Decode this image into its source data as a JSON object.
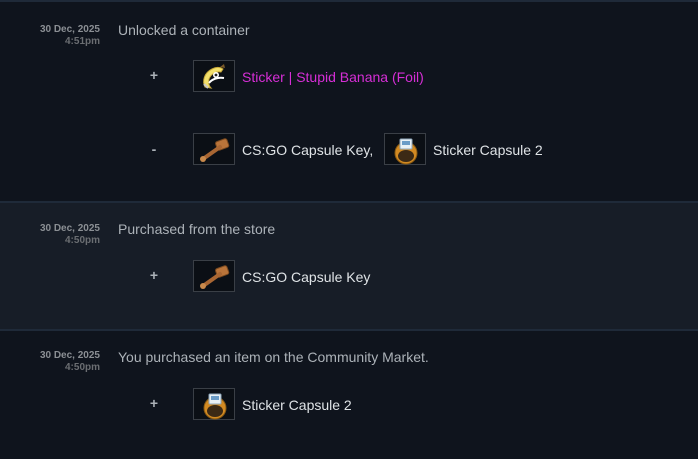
{
  "entries": [
    {
      "date": "30 Dec, 2025",
      "time": "4:51pm",
      "description": "Unlocked a container",
      "groups": [
        {
          "sign": "+",
          "items": [
            {
              "name": "Sticker | Stupid Banana (Foil)",
              "icon": "banana-sticker-icon",
              "color": "#d62ed6"
            }
          ]
        },
        {
          "sign": "-",
          "items": [
            {
              "name": "CS:GO Capsule Key,",
              "icon": "capsule-key-icon"
            },
            {
              "name": "Sticker Capsule 2",
              "icon": "sticker-capsule-icon"
            }
          ]
        }
      ]
    },
    {
      "date": "30 Dec, 2025",
      "time": "4:50pm",
      "description": "Purchased from the store",
      "groups": [
        {
          "sign": "+",
          "items": [
            {
              "name": "CS:GO Capsule Key",
              "icon": "capsule-key-icon"
            }
          ]
        }
      ]
    },
    {
      "date": "30 Dec, 2025",
      "time": "4:50pm",
      "description": "You purchased an item on the Community Market.",
      "groups": [
        {
          "sign": "+",
          "items": [
            {
              "name": "Sticker Capsule 2",
              "icon": "sticker-capsule-icon"
            }
          ]
        }
      ]
    }
  ]
}
